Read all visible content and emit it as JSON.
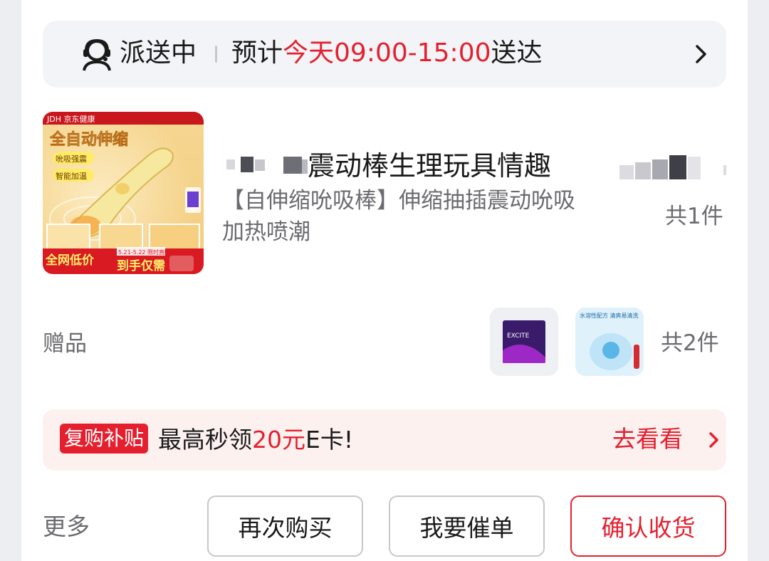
{
  "delivery": {
    "status": "派送中",
    "eta_prefix": "预计",
    "eta_highlight": "今天09:00-15:00",
    "eta_suffix": "送达"
  },
  "product": {
    "title": "震动棒生理玩具情趣",
    "description": "【自伸缩吮吸棒】伸缩抽插震动吮吸加热喷潮",
    "quantity": "共1件",
    "image_text": {
      "brand": "JDH 京东健康",
      "headline": "全自动伸缩",
      "tag1": "吮吸强震",
      "tag2": "智能加温",
      "promo": "全网低价",
      "promo_sub": "到手仅需",
      "date_range": "5.21-5.22 限时直降"
    }
  },
  "gifts": {
    "label": "赠品",
    "quantity": "共2件",
    "items": [
      {
        "image_text": "EXCITE"
      },
      {
        "image_text": "水溶性配方 清爽易清洗"
      }
    ]
  },
  "promo": {
    "badge": "复购补贴",
    "text_prefix": "最高秒领",
    "text_highlight": "20元",
    "text_suffix": "E卡!",
    "link_label": "去看看"
  },
  "actions": {
    "more_label": "更多",
    "rebuy_label": "再次购买",
    "urge_label": "我要催单",
    "confirm_label": "确认收货"
  },
  "colors": {
    "accent_red": "#e4202f",
    "muted_text": "#6b6b70",
    "bar_bg": "#f3f4f7",
    "banner_bg": "#fdf1f0"
  }
}
